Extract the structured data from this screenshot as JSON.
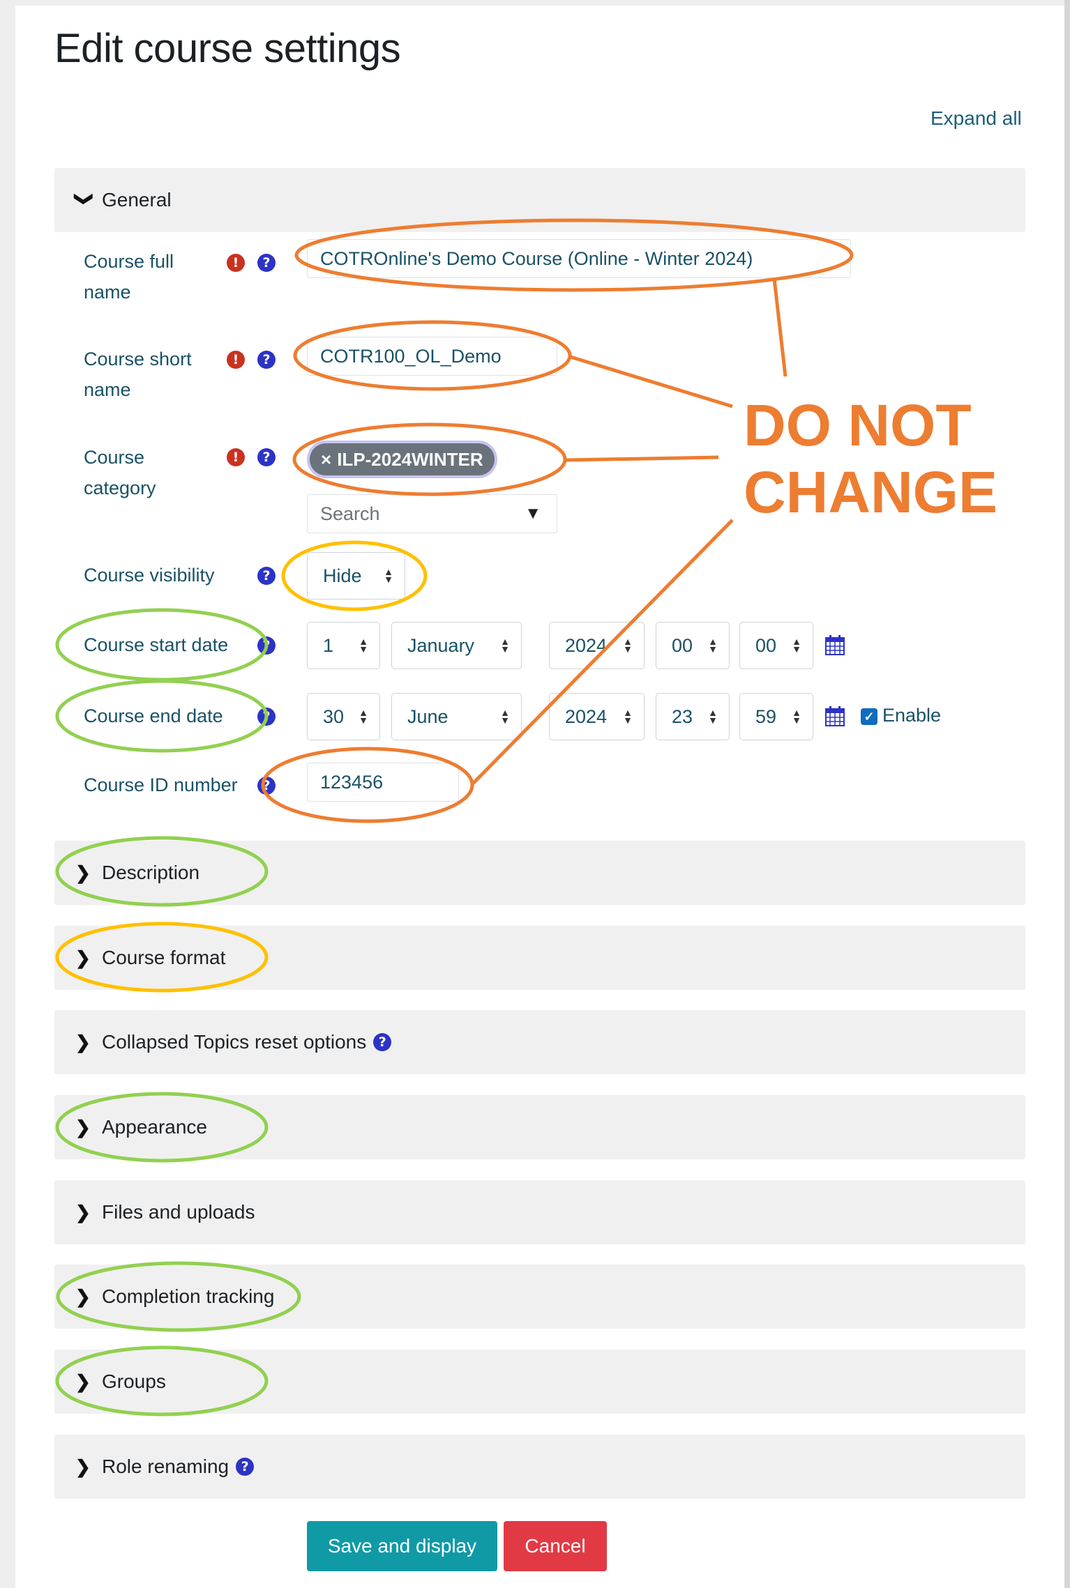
{
  "page": {
    "title": "Edit course settings",
    "expand_all": "Expand all"
  },
  "general": {
    "header": "General",
    "fields": {
      "full_name": {
        "label_line1": "Course full",
        "label_line2": "name",
        "value": "COTROnline's Demo Course (Online - Winter 2024)"
      },
      "short_name": {
        "label_line1": "Course short",
        "label_line2": "name",
        "value": "COTR100_OL_Demo"
      },
      "category": {
        "label_line1": "Course",
        "label_line2": "category",
        "selected": "ILP-2024WINTER",
        "remove_glyph": "×",
        "search_placeholder": "Search",
        "dropdown_glyph": "▼"
      },
      "visibility": {
        "label": "Course visibility",
        "value": "Hide"
      },
      "start_date": {
        "label": "Course start date",
        "day": "1",
        "month": "January",
        "year": "2024",
        "hour": "00",
        "minute": "00"
      },
      "end_date": {
        "label": "Course end date",
        "day": "30",
        "month": "June",
        "year": "2024",
        "hour": "23",
        "minute": "59",
        "enable_label": "Enable",
        "enabled": true
      },
      "id_number": {
        "label": "Course ID number",
        "value": "123456"
      }
    }
  },
  "icons": {
    "required": "!",
    "help": "?",
    "chevron_down": "❯",
    "chevron_right": "❯",
    "check": "✓",
    "arrow_up": "▲",
    "arrow_down": "▼"
  },
  "sections": [
    {
      "label": "Description",
      "help": false
    },
    {
      "label": "Course format",
      "help": false
    },
    {
      "label": "Collapsed Topics reset options",
      "help": true
    },
    {
      "label": "Appearance",
      "help": false
    },
    {
      "label": "Files and uploads",
      "help": false
    },
    {
      "label": "Completion tracking",
      "help": false
    },
    {
      "label": "Groups",
      "help": false
    },
    {
      "label": "Role renaming",
      "help": true
    }
  ],
  "buttons": {
    "save": "Save and display",
    "cancel": "Cancel"
  },
  "annotation": {
    "line1": "DO NOT",
    "line2": "CHANGE",
    "colors": {
      "do_not_change": "#ed7d31",
      "caution": "#ffc000",
      "change": "#92d050"
    }
  },
  "colors": {
    "save_button": "#0f9aa6",
    "cancel_button": "#e13a45",
    "required_icon": "#ca3120",
    "help_icon": "#2c33c5",
    "section_bg": "#f0f0f0",
    "label_text": "#1a5266"
  }
}
